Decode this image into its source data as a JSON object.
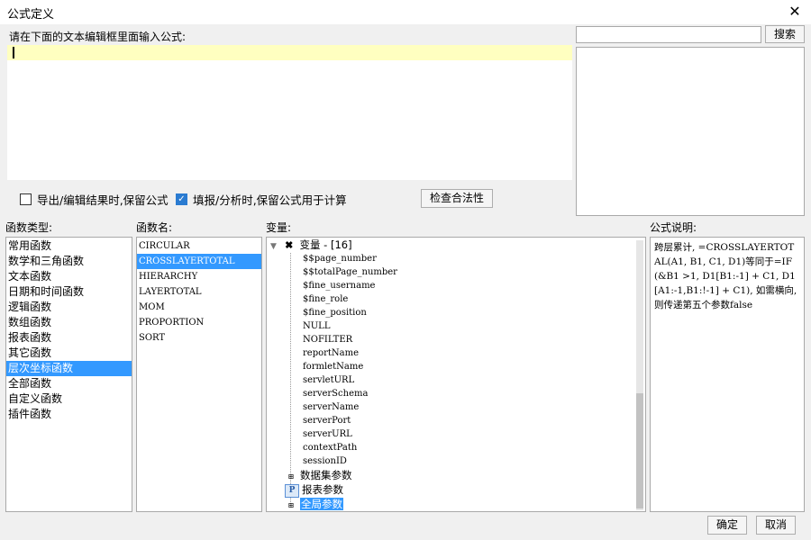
{
  "window": {
    "title": "公式定义"
  },
  "editor": {
    "label": "请在下面的文本编辑框里面输入公式:",
    "value": ""
  },
  "search": {
    "placeholder": "",
    "button_label": "搜索"
  },
  "options": {
    "keep_formula_export_label": "导出/编辑结果时,保留公式",
    "keep_formula_export_checked": false,
    "keep_formula_fill_label": "填报/分析时,保留公式用于计算",
    "keep_formula_fill_checked": true,
    "check_button_label": "检查合法性"
  },
  "function_types": {
    "label": "函数类型:",
    "items": [
      "常用函数",
      "数学和三角函数",
      "文本函数",
      "日期和时间函数",
      "逻辑函数",
      "数组函数",
      "报表函数",
      "其它函数",
      "层次坐标函数",
      "全部函数",
      "自定义函数",
      "插件函数"
    ],
    "selected_index": 8
  },
  "function_names": {
    "label": "函数名:",
    "items": [
      "CIRCULAR",
      "CROSSLAYERTOTAL",
      "HIERARCHY",
      "LAYERTOTAL",
      "MOM",
      "PROPORTION",
      "SORT"
    ],
    "selected_index": 1
  },
  "variables": {
    "label": "变量:",
    "root_label": "变量 - [16]",
    "items": [
      "$$page_number",
      "$$totalPage_number",
      "$fine_username",
      "$fine_role",
      "$fine_position",
      "NULL",
      "NOFILTER",
      "reportName",
      "formletName",
      "servletURL",
      "serverSchema",
      "serverName",
      "serverPort",
      "serverURL",
      "contextPath",
      "sessionID"
    ],
    "groups": [
      {
        "icon": "dataset-param-icon",
        "label": "数据集参数"
      },
      {
        "icon": "report-param-icon",
        "label": "报表参数"
      },
      {
        "icon": "global-param-icon",
        "label": "全局参数"
      }
    ]
  },
  "description": {
    "label": "公式说明:",
    "text": "跨层累计, =CROSSLAYERTOTAL(A1, B1, C1, D1)等同于=IF(&B1 >1, D1[B1:-1] + C1, D1[A1:-1,B1:!-1] + C1), 如需横向, 则传递第五个参数false"
  },
  "footer": {
    "ok_label": "确定",
    "cancel_label": "取消"
  },
  "colors": {
    "selection": "#3399ff",
    "editor_highlight": "#ffffc0"
  }
}
